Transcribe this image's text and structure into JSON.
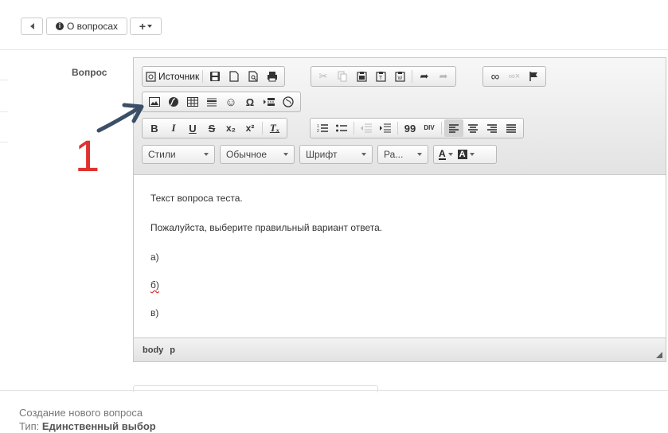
{
  "header": {
    "about_label": "О вопросах"
  },
  "field": {
    "label": "Вопрос"
  },
  "toolbar": {
    "source_label": "Источник",
    "styles": "Стили",
    "format": "Обычное",
    "font": "Шрифт",
    "size": "Ра...",
    "bold": "B",
    "italic": "I",
    "underline": "U",
    "strike": "S",
    "subscript": "x₂",
    "superscript": "x²",
    "remove_format": "Tₓ",
    "blockquote": "99",
    "div": "DIV",
    "omega": "Ω",
    "text_color": "A",
    "bg_color": "A"
  },
  "content": {
    "lines": [
      "Текст вопроса теста.",
      "Пожалуйста, выберите правильный вариант ответа.",
      "а)",
      "б)",
      "в)"
    ]
  },
  "statusbar": {
    "path": [
      "body",
      "p"
    ]
  },
  "annotation": {
    "number": "1",
    "color": "#e0322f"
  },
  "footer": {
    "line1": "Создание нового вопроса",
    "type_prefix": "Тип: ",
    "type_value": "Единственный выбор"
  }
}
